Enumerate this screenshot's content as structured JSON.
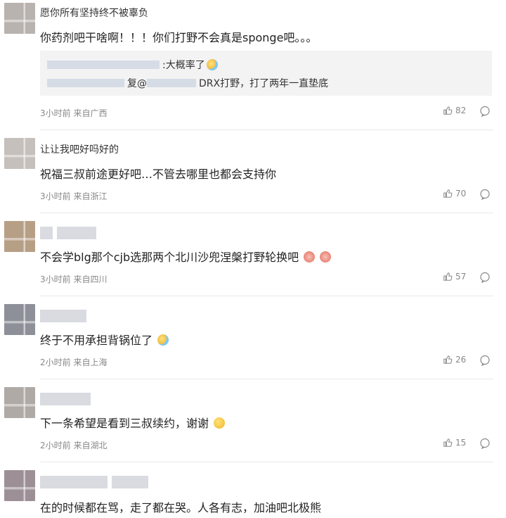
{
  "comments": [
    {
      "username": "愿你所有坚持终不被辜负",
      "text": "你药剂吧干啥啊！！！你们打野不会真是sponge吧。。。",
      "quote_line1": ":大概率了",
      "quote_line2_prefix": "复@",
      "quote_line2_suffix": "DRX打野，打了两年一直垫底",
      "meta": "3小时前 来自广西",
      "likes": "82",
      "avatar_color": "#b9b3af"
    },
    {
      "username": "让让我吧好吗好的",
      "text": "祝福三叔前途更好吧…不管去哪里也都会支持你",
      "meta": "3小时前 来自浙江",
      "likes": "70",
      "avatar_color": "#c6c0bc"
    },
    {
      "username": "",
      "text": "不会学blg那个cjb选那两个北川沙兜涅槃打野轮换吧",
      "meta": "3小时前 来自四川",
      "likes": "57",
      "avatar_color": "#b79f86"
    },
    {
      "username": "",
      "text": "终于不用承担背锅位了",
      "meta": "2小时前 来自上海",
      "likes": "26",
      "avatar_color": "#8e9099"
    },
    {
      "username": "",
      "text": "下一条希望是看到三叔续约，谢谢",
      "meta": "2小时前 来自湖北",
      "likes": "15",
      "avatar_color": "#b0aaa6"
    },
    {
      "username": "",
      "text": "在的时候都在骂，走了都在哭。人各有志，加油吧北极熊",
      "avatar_color": "#9d8f96"
    }
  ]
}
